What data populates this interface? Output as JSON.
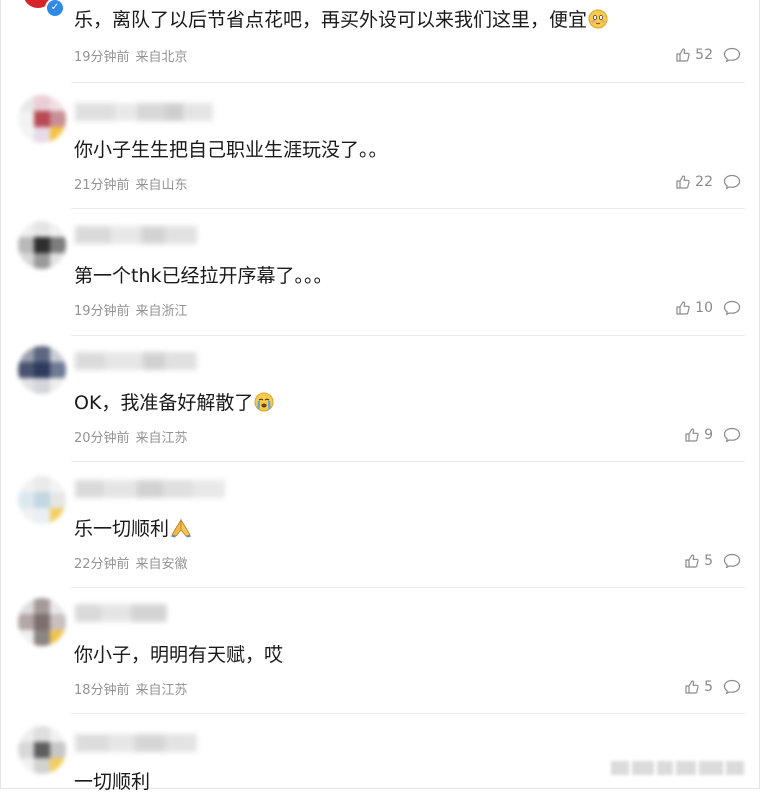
{
  "comments": [
    {
      "text": "乐，离队了以后节省点花吧，再买外设可以来我们这里，便宜",
      "emoji": "blush-face",
      "time": "19分钟前",
      "location": "来自北京",
      "likes": "52"
    },
    {
      "text": "你小子生生把自己职业生涯玩没了。。",
      "time": "21分钟前",
      "location": "来自山东",
      "likes": "22"
    },
    {
      "text": "第一个thk已经拉开序幕了。。。",
      "time": "19分钟前",
      "location": "来自浙江",
      "likes": "10"
    },
    {
      "text": "OK，我准备好解散了",
      "emoji": "crying-face",
      "time": "20分钟前",
      "location": "来自江苏",
      "likes": "9"
    },
    {
      "text": "乐一切顺利",
      "emoji": "praying-hands",
      "time": "22分钟前",
      "location": "来自安徽",
      "likes": "5"
    },
    {
      "text": "你小子，明明有天赋，哎",
      "time": "18分钟前",
      "location": "来自江苏",
      "likes": "5"
    },
    {
      "text": "一切顺利"
    }
  ],
  "icons": {
    "like": "thumbs-up-icon",
    "reply": "comment-bubble-icon"
  },
  "colors": {
    "meta_text": "#939393",
    "icon": "#8a8a8a",
    "verified_badge": "#2e8ae6"
  }
}
